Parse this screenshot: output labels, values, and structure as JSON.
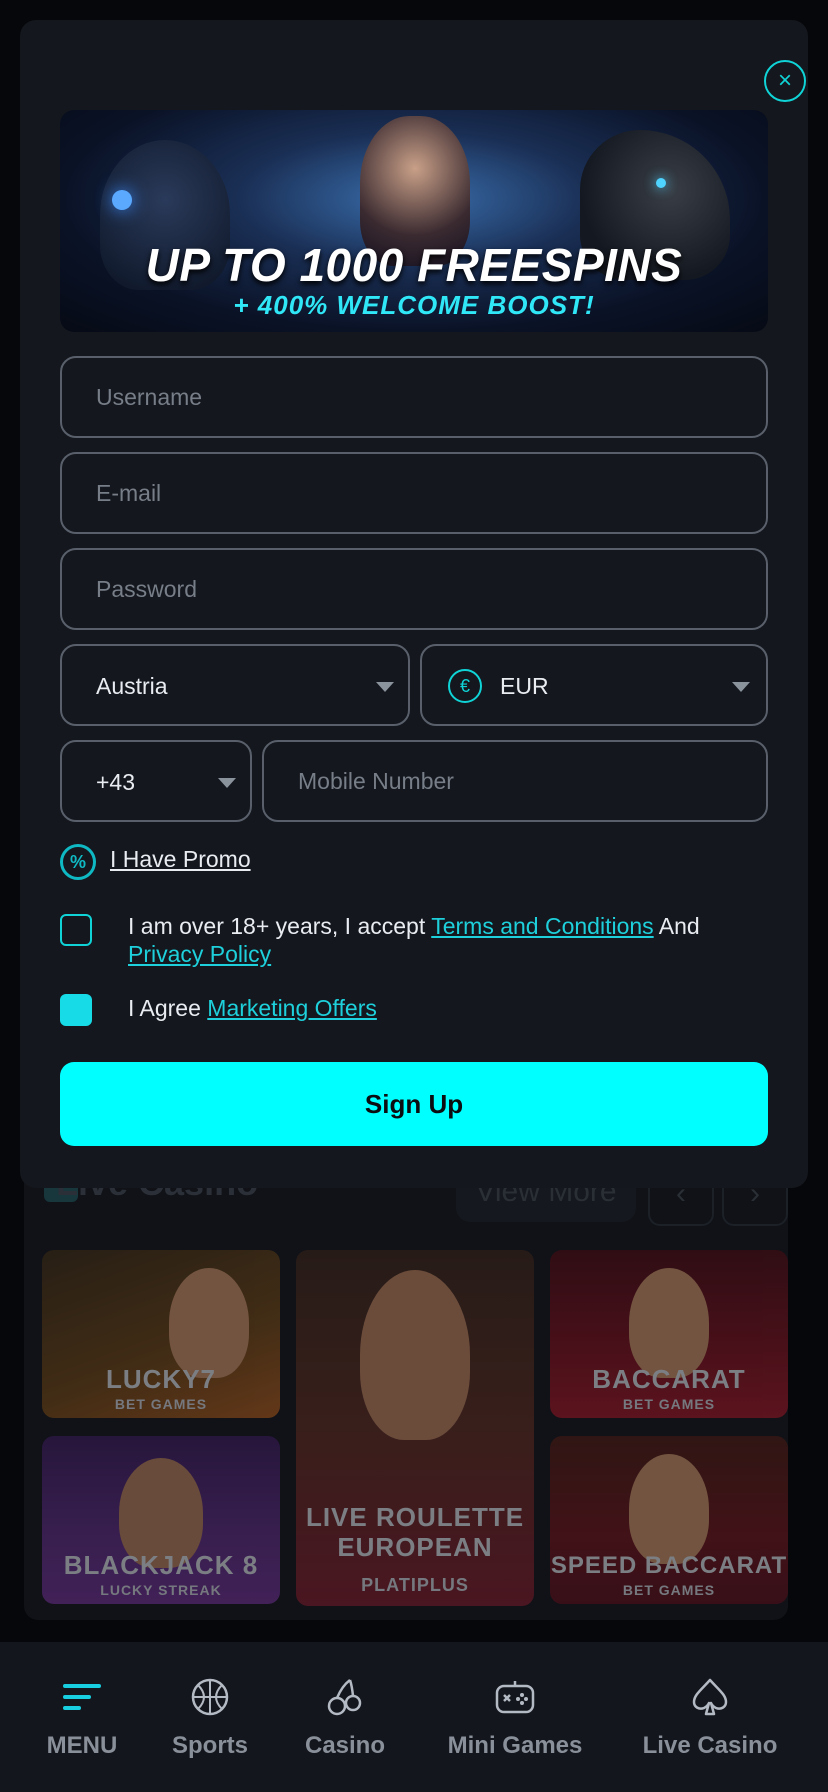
{
  "background": {
    "section_title": "Live Casino",
    "view_more": "View More",
    "prev_arrow": "‹",
    "next_arrow": "›",
    "games": [
      {
        "title": "LUCKY7",
        "subtitle": "BET GAMES"
      },
      {
        "title": "LIVE ROULETTE EUROPEAN",
        "subtitle": "PLATIPLUS"
      },
      {
        "title": "BACCARAT",
        "subtitle": "BET GAMES"
      },
      {
        "title": "BLACKJACK 8",
        "subtitle": "LUCKY STREAK"
      },
      {
        "title": "SPEED BACCARAT",
        "subtitle": "BET GAMES"
      }
    ]
  },
  "modal": {
    "close_icon": "×",
    "banner": {
      "headline": "UP TO 1000 FREESPINS",
      "subline": "+ 400% WELCOME BOOST!"
    },
    "fields": {
      "username_placeholder": "Username",
      "email_placeholder": "E-mail",
      "password_placeholder": "Password",
      "country": "Austria",
      "currency_symbol": "€",
      "currency": "EUR",
      "phone_code": "+43",
      "mobile_placeholder": "Mobile Number"
    },
    "promo": {
      "icon_glyph": "%",
      "label": "I Have Promo"
    },
    "consent": {
      "age_text": "I am over 18+ years, I accept",
      "terms_link": "Terms and Conditions",
      "and_text": "And",
      "privacy_link": "Privacy Policy",
      "age_checked": false,
      "marketing_text": "I Agree",
      "marketing_link": "Marketing Offers",
      "marketing_checked": true
    },
    "signup_label": "Sign Up"
  },
  "bottom_nav": {
    "items": [
      {
        "label": "MENU",
        "icon": "menu-icon"
      },
      {
        "label": "Sports",
        "icon": "basketball-icon"
      },
      {
        "label": "Casino",
        "icon": "cherries-icon"
      },
      {
        "label": "Mini Games",
        "icon": "gamepad-icon"
      },
      {
        "label": "Live Casino",
        "icon": "spade-icon"
      }
    ]
  },
  "colors": {
    "accent": "#00ffff",
    "link": "#1ed0db",
    "modal_bg": "#14171d",
    "page_bg": "#06070a"
  }
}
